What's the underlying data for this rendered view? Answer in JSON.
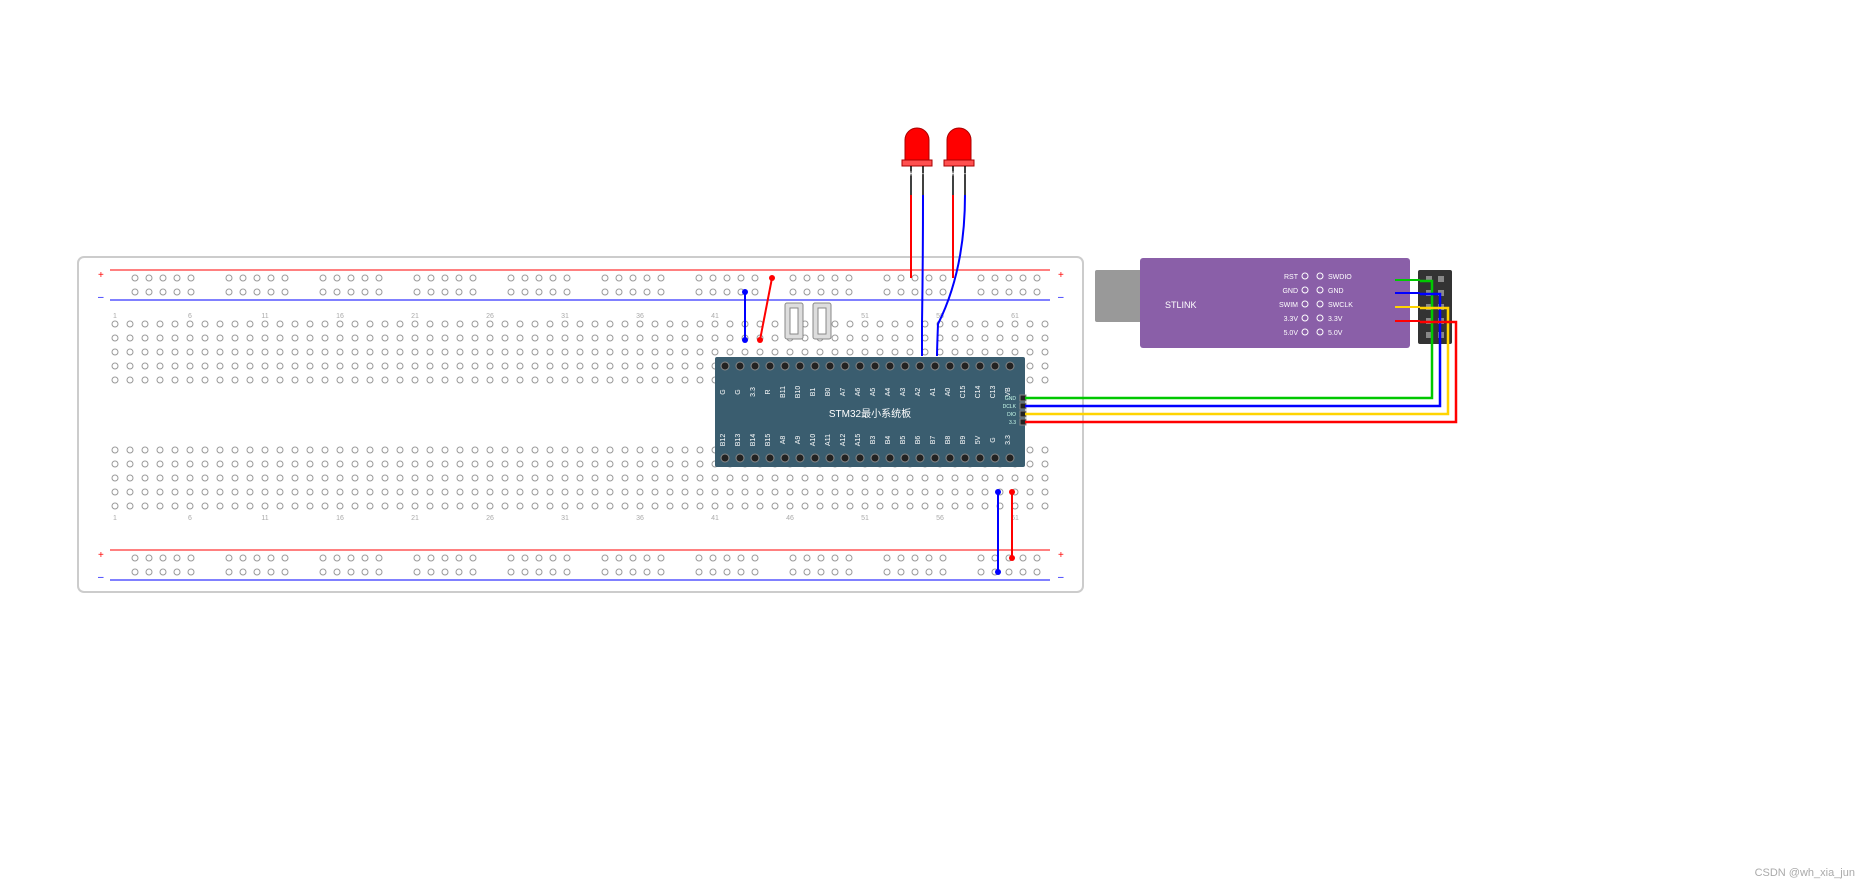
{
  "watermark": "CSDN @wh_xia_jun",
  "stm32": {
    "label": "STM32最小系统板",
    "top_pins": [
      "G",
      "G",
      "3.3",
      "R",
      "B11",
      "B10",
      "B1",
      "B0",
      "A7",
      "A6",
      "A5",
      "A4",
      "A3",
      "A2",
      "A1",
      "A0",
      "C15",
      "C14",
      "C13",
      "VB"
    ],
    "bottom_pins": [
      "B12",
      "B13",
      "B14",
      "B15",
      "A8",
      "A9",
      "A10",
      "A11",
      "A12",
      "A15",
      "B3",
      "B4",
      "B5",
      "B6",
      "B7",
      "B8",
      "B9",
      "5V",
      "G",
      "3.3"
    ],
    "debug_pins": [
      "GND",
      "DCLK",
      "DIO",
      "3.3"
    ]
  },
  "stlink": {
    "label": "STLINK",
    "left_labels": [
      "RST",
      "GND",
      "SWIM",
      "3.3V",
      "5.0V"
    ],
    "right_labels": [
      "SWDIO",
      "GND",
      "SWCLK",
      "3.3V",
      "5.0V"
    ]
  },
  "leds": {
    "plus": "+",
    "minus": "–"
  },
  "wire_colors": {
    "green": "#00c800",
    "blue": "#0000ff",
    "yellow": "#ffd400",
    "red": "#ff0000"
  }
}
